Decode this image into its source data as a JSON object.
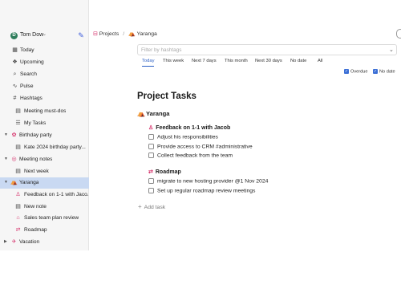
{
  "user": {
    "initial": "D",
    "name": "Tom Dow"
  },
  "sidebar": {
    "items": [
      {
        "label": "Today",
        "icon": "calendar-icon"
      },
      {
        "label": "Upcoming",
        "icon": "upcoming-icon"
      },
      {
        "label": "Search",
        "icon": "search-icon"
      },
      {
        "label": "Pulse",
        "icon": "pulse-icon"
      },
      {
        "label": "Hashtags",
        "icon": "hashtag-icon"
      },
      {
        "label": "Meeting must-dos",
        "icon": "note-icon"
      },
      {
        "label": "My Tasks",
        "icon": "tasks-icon"
      },
      {
        "label": "Birthday party",
        "icon": "project-icon"
      },
      {
        "label": "Kate 2024 birthday party...",
        "icon": "note-icon"
      },
      {
        "label": "Meeting notes",
        "icon": "project-icon"
      },
      {
        "label": "Next week",
        "icon": "note-icon"
      },
      {
        "label": "Yaranga",
        "icon": "project-icon"
      },
      {
        "label": "Feedback on 1-1 with Jaco...",
        "icon": "person-icon"
      },
      {
        "label": "New note",
        "icon": "note-icon"
      },
      {
        "label": "Sales team plan review",
        "icon": "presentation-icon"
      },
      {
        "label": "Roadmap",
        "icon": "roadmap-icon"
      },
      {
        "label": "Vacation",
        "icon": "plane-icon"
      }
    ]
  },
  "breadcrumb": {
    "root": "Projects",
    "current": "Yaranga"
  },
  "filter": {
    "placeholder": "Filter by hashtags"
  },
  "date_tabs": [
    "Today",
    "This week",
    "Next 7 days",
    "This month",
    "Next 30 days",
    "No date",
    "All"
  ],
  "options": {
    "overdue": "Overdue",
    "no_date": "No date"
  },
  "main": {
    "title": "Project Tasks",
    "project": "Yaranga",
    "groups": [
      {
        "title": "Feedback on 1-1 with Jacob",
        "tasks": [
          "Adjust his responsibilities",
          "Provide access to CRM #administrative",
          "Collect feedback from the team"
        ]
      },
      {
        "title": "Roadmap",
        "tasks": [
          "migrate to new hosting provider @1 Nov 2024",
          "Set up regular roadmap review meetings"
        ]
      }
    ],
    "add_task": "Add task"
  },
  "colors": {
    "accent": "#2b5fc4",
    "selected_bg": "#c9d9f2",
    "avatar": "#2e7d5b",
    "task_icon": "#d6336c"
  }
}
